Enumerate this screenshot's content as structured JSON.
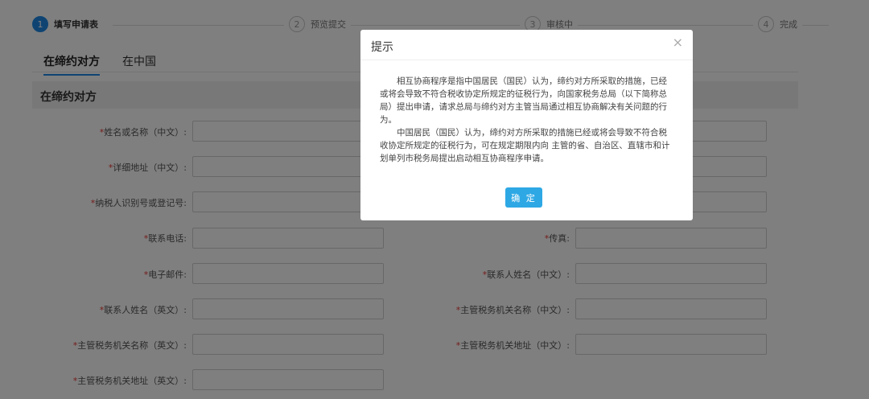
{
  "steps": [
    {
      "num": "1",
      "label": "填写申请表"
    },
    {
      "num": "2",
      "label": "预览提交"
    },
    {
      "num": "3",
      "label": "审核中"
    },
    {
      "num": "4",
      "label": "完成"
    }
  ],
  "tabs": [
    {
      "label": "在缔约对方"
    },
    {
      "label": "在中国"
    }
  ],
  "section": {
    "title": "在缔约对方"
  },
  "form": {
    "name_cn": "姓名或名称（中文）:",
    "address_cn": "详细地址（中文）:",
    "taxpayer_id": "纳税人识别号或登记号:",
    "phone": "联系电话:",
    "fax": "传真:",
    "email": "电子邮件:",
    "contact_name_cn": "联系人姓名（中文）:",
    "contact_name_en": "联系人姓名（英文）:",
    "tax_authority_name_cn": "主管税务机关名称（中文）:",
    "tax_authority_name_en": "主管税务机关名称（英文）:",
    "tax_authority_address_cn": "主管税务机关地址（中文）:",
    "tax_authority_address_en": "主管税务机关地址（英文）:",
    "required_mark": "*"
  },
  "dialog": {
    "title": "提示",
    "close": "×",
    "paragraph1": "相互协商程序是指中国居民（国民）认为，缔约对方所采取的措施，已经或将会导致不符合税收协定所规定的征税行为，向国家税务总局（以下简称总局）提出申请，请求总局与缔约对方主管当局通过相互协商解决有关问题的行为。",
    "paragraph2": "中国居民（国民）认为，缔约对方所采取的措施已经或将会导致不符合税收协定所规定的征税行为，可在规定期限内向 主管的省、自治区、直辖市和计划单列市税务局提出启动相互协商程序申请。",
    "ok_label": "确 定"
  }
}
